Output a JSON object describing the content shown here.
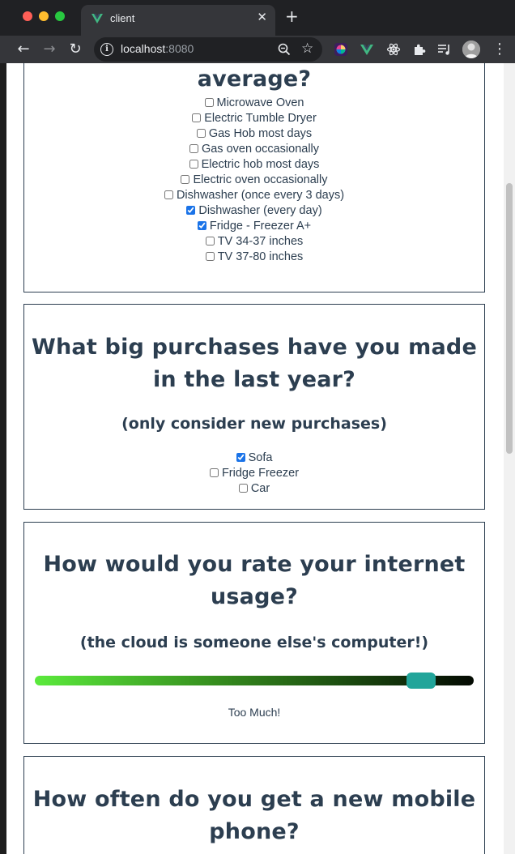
{
  "browser": {
    "tab_title": "client",
    "tab_close": "✕",
    "new_tab": "+",
    "url_host": "localhost",
    "url_port": ":8080",
    "nav": {
      "back": "←",
      "forward": "→",
      "reload": "↻"
    },
    "menu": "⋮",
    "star": "☆"
  },
  "appliances": {
    "title_tail": "average?",
    "options": [
      {
        "label": "Microwave Oven",
        "checked": false
      },
      {
        "label": "Electric Tumble Dryer",
        "checked": false
      },
      {
        "label": "Gas Hob most days",
        "checked": false
      },
      {
        "label": "Gas oven occasionally",
        "checked": false
      },
      {
        "label": "Electric hob most days",
        "checked": false
      },
      {
        "label": "Electric oven occasionally",
        "checked": false
      },
      {
        "label": "Dishwasher (once every 3 days)",
        "checked": false
      },
      {
        "label": "Dishwasher (every day)",
        "checked": true
      },
      {
        "label": "Fridge - Freezer A+",
        "checked": true
      },
      {
        "label": "TV 34-37 inches",
        "checked": false
      },
      {
        "label": "TV 37-80 inches",
        "checked": false
      }
    ]
  },
  "purchases": {
    "title": "What big purchases have you made in the last year?",
    "subtitle": "(only consider new purchases)",
    "options": [
      {
        "label": "Sofa",
        "checked": true
      },
      {
        "label": "Fridge Freezer",
        "checked": false
      },
      {
        "label": "Car",
        "checked": false
      }
    ]
  },
  "internet": {
    "title": "How would you rate your internet usage?",
    "subtitle": "(the cloud is someone else's computer!)",
    "slider_level": 0.88,
    "value_label": "Too Much!"
  },
  "mobile": {
    "title": "How often do you get a new mobile phone?"
  },
  "colors": {
    "text": "#2c3e50",
    "slider_thumb": "#22a59a",
    "chrome_bg": "#202124"
  }
}
